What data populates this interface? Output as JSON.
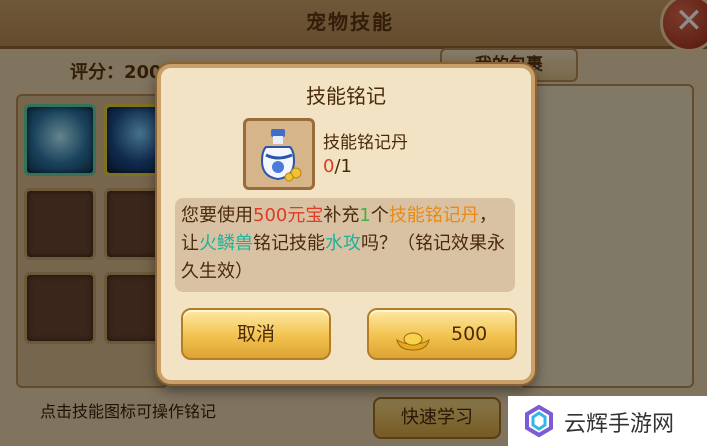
{
  "background": {
    "title": "宠物技能",
    "score_label": "评分：2000",
    "bag_tab": "我的包裹",
    "hint": "点击技能图标可操作铭记",
    "quick_learn_button": "快速学习",
    "close_icon": "close-x-icon"
  },
  "dialog": {
    "title": "技能铭记",
    "item": {
      "name": "技能铭记丹",
      "have": "0",
      "need": "/1",
      "icon": "potion-bottle-icon"
    },
    "message": {
      "p1": "您要使用",
      "cost": "500元宝",
      "p2": "补充",
      "qty": "1",
      "p3": "个",
      "item": "技能铭记丹",
      "p4": "，让",
      "pet": "火鳞兽",
      "p5": "铭记技能",
      "skill": "水攻",
      "p6": "吗？（铭记效果永久生效）"
    },
    "cancel_button": "取消",
    "buy_button": "500",
    "buy_icon": "gold-ingot-icon"
  },
  "watermark": {
    "text": "云辉手游网",
    "logo_icon": "brand-logo-icon"
  },
  "colors": {
    "cost": "#e03b24",
    "qty": "#43b03f",
    "item": "#e98a12",
    "pet": "#1eb29a",
    "skill": "#1eb29a"
  }
}
